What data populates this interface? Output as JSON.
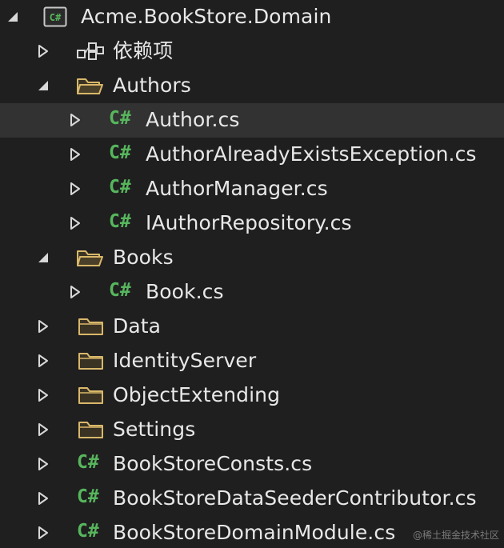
{
  "tree": {
    "rows": [
      {
        "label": "Acme.BookStore.Domain",
        "icon": "csharp-project-icon",
        "expanded": true
      },
      {
        "label": "依赖项",
        "icon": "dependencies-icon",
        "expanded": false
      },
      {
        "label": "Authors",
        "icon": "folder-open-icon",
        "expanded": true
      },
      {
        "label": "Author.cs",
        "icon": "csharp-file-icon",
        "expanded": false,
        "selected": true
      },
      {
        "label": "AuthorAlreadyExistsException.cs",
        "icon": "csharp-file-icon",
        "expanded": false
      },
      {
        "label": "AuthorManager.cs",
        "icon": "csharp-file-icon",
        "expanded": false
      },
      {
        "label": "IAuthorRepository.cs",
        "icon": "csharp-file-icon",
        "expanded": false
      },
      {
        "label": "Books",
        "icon": "folder-open-icon",
        "expanded": true
      },
      {
        "label": "Book.cs",
        "icon": "csharp-file-icon",
        "expanded": false
      },
      {
        "label": "Data",
        "icon": "folder-icon",
        "expanded": false
      },
      {
        "label": "IdentityServer",
        "icon": "folder-icon",
        "expanded": false
      },
      {
        "label": "ObjectExtending",
        "icon": "folder-icon",
        "expanded": false
      },
      {
        "label": "Settings",
        "icon": "folder-icon",
        "expanded": false
      },
      {
        "label": "BookStoreConsts.cs",
        "icon": "csharp-file-icon",
        "expanded": false
      },
      {
        "label": "BookStoreDataSeederContributor.cs",
        "icon": "csharp-file-icon",
        "expanded": false
      },
      {
        "label": "BookStoreDomainModule.cs",
        "icon": "csharp-file-icon",
        "expanded": false
      }
    ]
  },
  "glyphs": {
    "csharp": "C#"
  },
  "watermark": "@稀土掘金技术社区",
  "colors": {
    "background": "#1f1f1f",
    "selected_row": "#323232",
    "csharp_green": "#57b65d",
    "folder_fill": "#3a3324",
    "folder_stroke": "#d9b86a",
    "text": "#e8e8e8"
  }
}
